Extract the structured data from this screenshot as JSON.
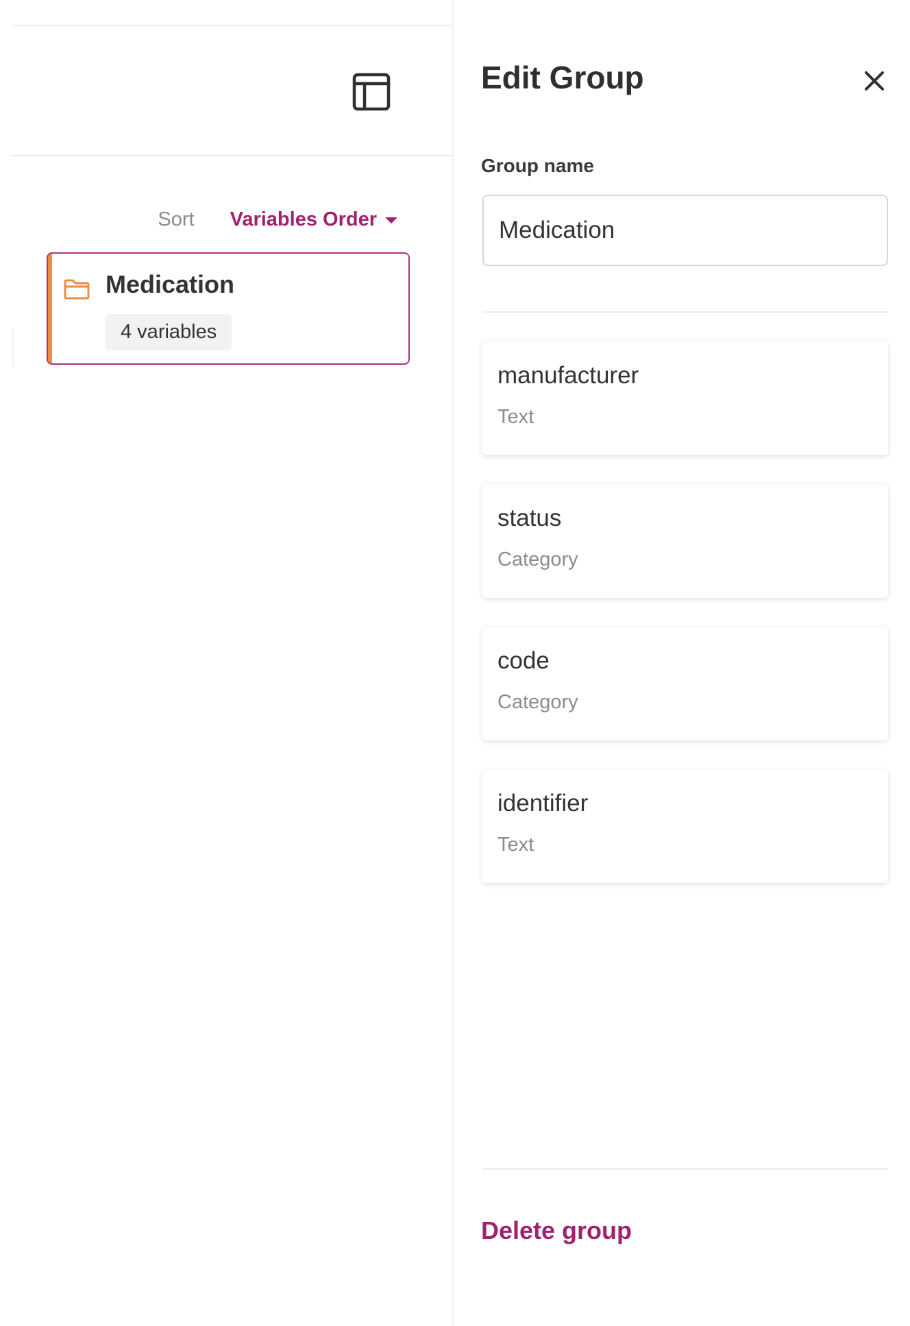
{
  "left_pane": {
    "sort": {
      "label": "Sort",
      "selected": "Variables Order"
    },
    "group_card": {
      "title": "Medication",
      "badge": "4 variables"
    }
  },
  "drawer": {
    "title": "Edit Group",
    "group_name": {
      "label": "Group name",
      "value": "Medication"
    },
    "variables": [
      {
        "name": "manufacturer",
        "type": "Text"
      },
      {
        "name": "status",
        "type": "Category"
      },
      {
        "name": "code",
        "type": "Category"
      },
      {
        "name": "identifier",
        "type": "Text"
      }
    ],
    "delete_label": "Delete group"
  },
  "colors": {
    "accent": "#a0216e",
    "card_border": "#b32f7e",
    "folder_orange": "#f08a3e",
    "muted_text": "#8c8c8c"
  },
  "icons": {
    "layout_toggle": "layout-sidebar-icon",
    "folder": "folder-icon",
    "close": "close-icon",
    "caret": "caret-down-icon"
  }
}
